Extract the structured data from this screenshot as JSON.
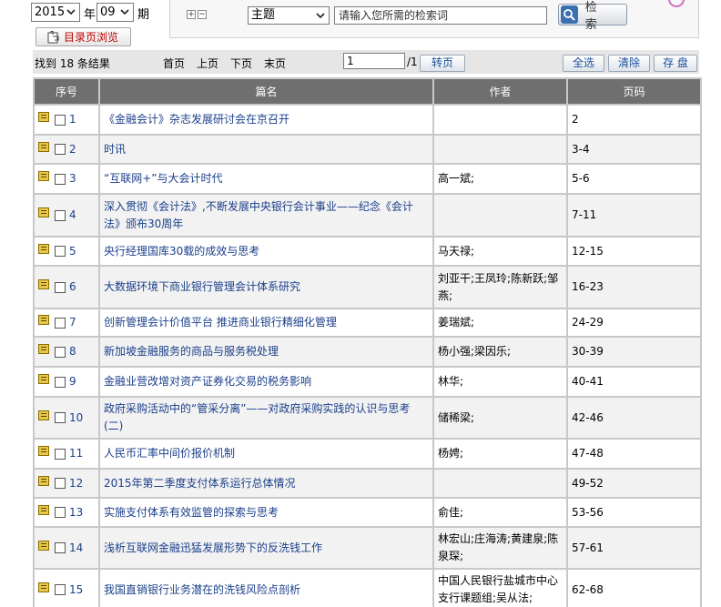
{
  "selectors": {
    "year": "2015",
    "year_label": "年",
    "issue": "09",
    "issue_label": "期",
    "toc_button": "目录页浏览"
  },
  "search": {
    "field": "主题",
    "placeholder": "请输入您所需的检索词",
    "button": "检 索"
  },
  "results_bar": {
    "found": "找到 18 条结果",
    "first": "首页",
    "prev": "上页",
    "next": "下页",
    "last": "末页",
    "page_value": "1",
    "page_total": "/1",
    "goto": "转页",
    "select_all": "全选",
    "clear": "清除",
    "save": "存 盘"
  },
  "table": {
    "headers": [
      "序号",
      "篇名",
      "作者",
      "页码"
    ],
    "rows": [
      {
        "no": "1",
        "title": "《金融会计》杂志发展研讨会在京召开",
        "author": "",
        "pages": "2"
      },
      {
        "no": "2",
        "title": "时讯",
        "author": "",
        "pages": "3-4"
      },
      {
        "no": "3",
        "title": "“互联网+”与大会计时代",
        "author": "高一斌;",
        "pages": "5-6"
      },
      {
        "no": "4",
        "title": "深入贯彻《会计法》,不断发展中央银行会计事业——纪念《会计法》颁布30周年",
        "author": "",
        "pages": "7-11"
      },
      {
        "no": "5",
        "title": "央行经理国库30载的成效与思考",
        "author": "马天禄;",
        "pages": "12-15"
      },
      {
        "no": "6",
        "title": "大数据环境下商业银行管理会计体系研究",
        "author": "刘亚干;王凤玲;陈新跃;邹燕;",
        "pages": "16-23"
      },
      {
        "no": "7",
        "title": "创新管理会计价值平台 推进商业银行精细化管理",
        "author": "姜瑞斌;",
        "pages": "24-29"
      },
      {
        "no": "8",
        "title": "新加坡金融服务的商品与服务税处理",
        "author": "杨小强;梁因乐;",
        "pages": "30-39"
      },
      {
        "no": "9",
        "title": "金融业营改增对资产证券化交易的税务影响",
        "author": "林华;",
        "pages": "40-41"
      },
      {
        "no": "10",
        "title": "政府采购活动中的“管采分离”——对政府采购实践的认识与思考(二)",
        "author": "储稀梁;",
        "pages": "42-46"
      },
      {
        "no": "11",
        "title": "人民币汇率中间价报价机制",
        "author": "杨娉;",
        "pages": "47-48"
      },
      {
        "no": "12",
        "title": "2015年第二季度支付体系运行总体情况",
        "author": "",
        "pages": "49-52"
      },
      {
        "no": "13",
        "title": "实施支付体系有效监管的探索与思考",
        "author": "俞佳;",
        "pages": "53-56"
      },
      {
        "no": "14",
        "title": "浅析互联网金融迅猛发展形势下的反洗钱工作",
        "author": "林宏山;庄海涛;黄建泉;陈泉琛;",
        "pages": "57-61"
      },
      {
        "no": "15",
        "title": "我国直销银行业务潜在的洗钱风险点剖析",
        "author": "中国人民银行盐城市中心支行课题组;吴从法;",
        "pages": "62-68"
      }
    ]
  }
}
